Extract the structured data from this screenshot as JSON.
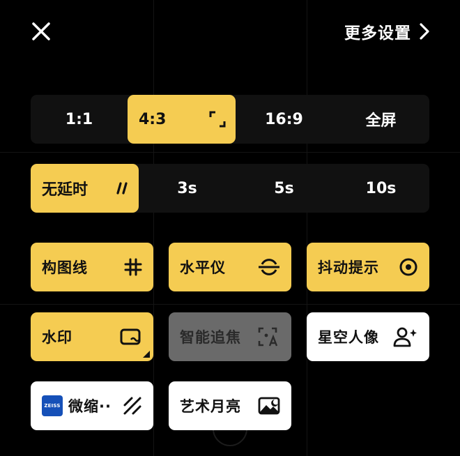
{
  "header": {
    "close_icon": "close-icon",
    "more_settings_label": "更多设置",
    "more_settings_icon": "chevron-right-icon"
  },
  "aspect_ratio": {
    "options": [
      "1:1",
      "4:3",
      "16:9",
      "全屏"
    ],
    "selected": "4:3",
    "selected_icon": "crop-frame-icon"
  },
  "timer": {
    "options": [
      "无延时",
      "3s",
      "5s",
      "10s"
    ],
    "selected": "无延时",
    "selected_icon": "timer-off-icon"
  },
  "tiles": [
    {
      "label": "构图线",
      "icon": "grid-icon",
      "state": "on"
    },
    {
      "label": "水平仪",
      "icon": "level-icon",
      "state": "on"
    },
    {
      "label": "抖动提示",
      "icon": "shake-hint-icon",
      "state": "on"
    },
    {
      "label": "水印",
      "icon": "watermark-icon",
      "state": "on"
    },
    {
      "label": "智能追焦",
      "icon": "smart-focus-icon",
      "state": "disabled"
    },
    {
      "label": "星空人像",
      "icon": "starry-portrait-icon",
      "state": "off"
    },
    {
      "label": "微缩··",
      "icon": "tilt-shift-icon",
      "state": "off",
      "badge": "ZEISS"
    },
    {
      "label": "艺术月亮",
      "icon": "art-moon-icon",
      "state": "off"
    }
  ],
  "colors": {
    "accent": "#f5cc52",
    "background": "#000000",
    "segment_bg": "#111111",
    "disabled": "#6a6a6a",
    "off_tile": "#ffffff",
    "zeiss_blue": "#1550b8"
  }
}
